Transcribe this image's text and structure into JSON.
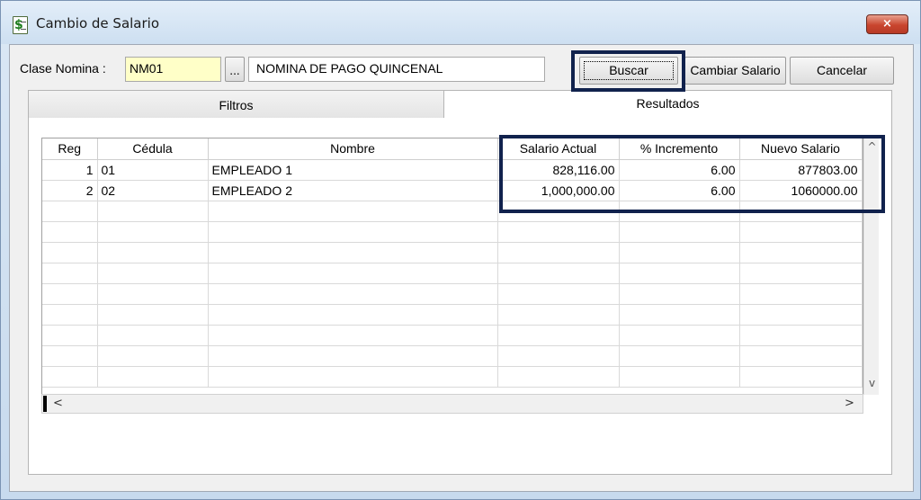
{
  "window": {
    "title": "Cambio de Salario",
    "close_symbol": "×"
  },
  "icons": {
    "app_icon": "$",
    "lookup_icon": "...",
    "scroll_up": "^",
    "scroll_down": "v",
    "scroll_left": "<",
    "scroll_right": ">"
  },
  "form": {
    "clase_label": "Clase Nomina :",
    "clase_code": "NM01",
    "clase_desc": "NOMINA DE PAGO QUINCENAL"
  },
  "toolbar": {
    "buscar_label": "Buscar",
    "cambiar_label": "Cambiar Salario",
    "cancelar_label": "Cancelar"
  },
  "tabs": [
    {
      "label": "Filtros"
    },
    {
      "label": "Resultados"
    }
  ],
  "table": {
    "headers": [
      "Reg",
      "Cédula",
      "Nombre",
      "Salario Actual",
      "% Incremento",
      "Nuevo Salario"
    ],
    "rows": [
      {
        "reg": "1",
        "cedula": "01",
        "nombre": "EMPLEADO 1",
        "salario_actual": "828,116.00",
        "incremento": "6.00",
        "nuevo_salario": "877803.00"
      },
      {
        "reg": "2",
        "cedula": "02",
        "nombre": "EMPLEADO 2",
        "salario_actual": "1,000,000.00",
        "incremento": "6.00",
        "nuevo_salario": "1060000.00"
      }
    ]
  },
  "colors": {
    "highlight_border": "#11224d",
    "code_field_bg": "#ffffc8",
    "close_button": "#c9452e"
  }
}
